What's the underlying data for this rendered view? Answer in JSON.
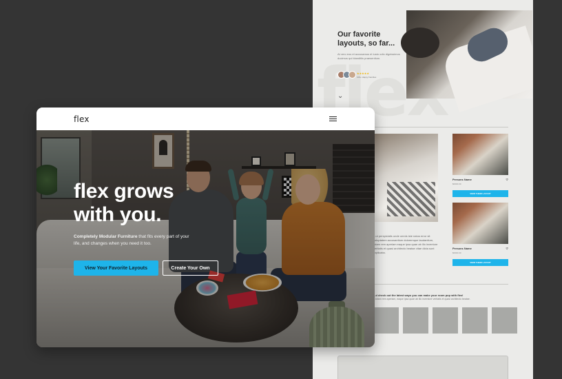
{
  "design_page": {
    "watermark": "flex",
    "hero_title": "Our favorite layouts, so far...",
    "hero_desc": "At vero eos et accusamus et iusto odio dignissimos ducimus qui blanditiis praesentium.",
    "rating_stars": "★★★★★",
    "rating_caption": "100+ Happy Families",
    "chevron": "⌄",
    "cards": [
      {
        "name": "Persons Name",
        "price": "$0000.00",
        "button": "VIEW THEIR LAYOUT"
      },
      {
        "name": "Persons Name",
        "price": "$0000.00",
        "button": "VIEW THEIR LAYOUT"
      }
    ],
    "text_block": "...ut perspiciatis unde omnis iste natus error sit voluptatem accusantium doloremque laudantium, totam rem aperiam eaque ipsa quae ab illo inventore veritatis et quasi architecto beatae vitae dicta sunt explicabo.",
    "insta_title": "...d check out the latest ways you can make your room pop with flex!",
    "insta_sub": "...totam rem aperiam, eaque ipsa quae ab illo inventore veritatis et quasi architecto beatae."
  },
  "browser": {
    "logo": "flex",
    "hero": {
      "title_line1": "flex grows",
      "title_line2": "with you.",
      "desc_bold": "Completely Modular Furniture",
      "desc_rest": " that fits every part of your life, and changes when you need it too.",
      "primary_button": "View Your Favorite Layouts",
      "secondary_button": "Create Your Own"
    }
  },
  "colors": {
    "backdrop": "#343434",
    "accent": "#1eb4ea",
    "design_page_bg": "#ebebe9"
  },
  "icons": [
    "menu-icon",
    "heart-icon",
    "chevron-down-icon"
  ]
}
